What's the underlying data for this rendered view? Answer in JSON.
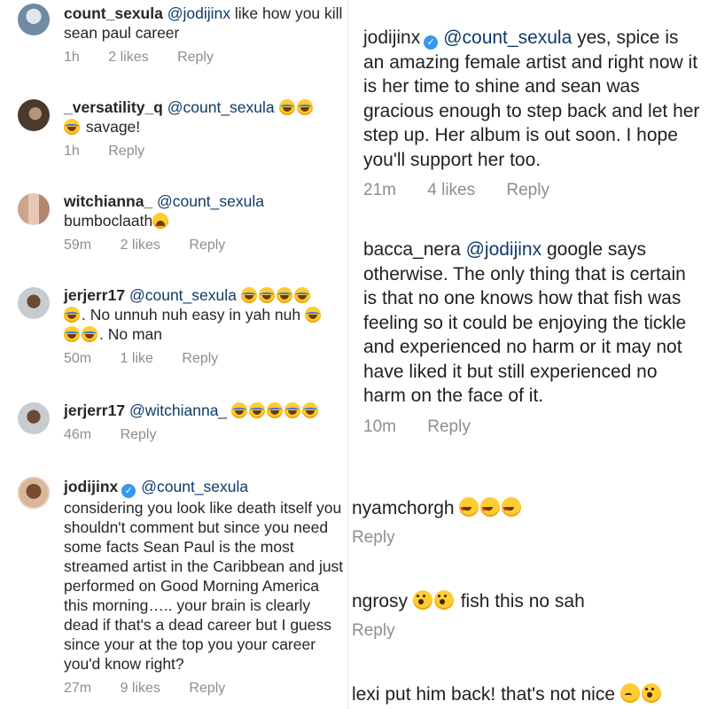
{
  "left_comments": [
    {
      "username": "count_sexula",
      "mention": "@jodijinx",
      "text": " like how you kill sean paul career",
      "time": "1h",
      "likes": "2 likes",
      "reply": "Reply"
    },
    {
      "username": "_versatility_q",
      "mention": "@count_sexula",
      "text": " savage!",
      "emoji_count": 3,
      "time": "1h",
      "reply": "Reply"
    },
    {
      "username": "witchianna_",
      "mention": "@count_sexula",
      "text": " bumboclaath",
      "time": "59m",
      "likes": "2 likes",
      "reply": "Reply"
    },
    {
      "username": "jerjerr17",
      "mention": "@count_sexula",
      "text_a": ". No unnuh nuh easy in yah nuh ",
      "text_b": ". No man",
      "time": "50m",
      "likes": "1 like",
      "reply": "Reply"
    },
    {
      "username": "jerjerr17",
      "mention": "@witchianna_",
      "time": "46m",
      "reply": "Reply"
    },
    {
      "username": "jodijinx",
      "mention": "@count_sexula",
      "text": "considering you look like death itself you shouldn't comment but since you need some facts Sean Paul is the most streamed artist in the Caribbean and just performed on Good Morning America this morning….. your brain is clearly dead if that's a dead career  but I guess since your at the top you your career you'd know right?",
      "time": "27m",
      "likes": "9 likes",
      "reply": "Reply"
    }
  ],
  "right_comments": [
    {
      "username": "jodijinx",
      "mention": "@count_sexula",
      "text": " yes, spice is an amazing female artist and right now it is her time to shine and sean was gracious enough to step back and let her step up. Her album is out soon. I hope you'll support her too.",
      "time": "21m",
      "likes": "4 likes",
      "reply": "Reply"
    },
    {
      "username": "bacca_nera",
      "mention": "@jodijinx",
      "text": " google says otherwise. The only thing that is certain is that no one knows how that fish was feeling so it could be enjoying the tickle and experienced no harm or it may not have liked it but still experienced no harm on the face of it.",
      "time": "10m",
      "reply": "Reply"
    },
    {
      "username": "nyamchorgh",
      "reply": "Reply"
    },
    {
      "username": "ngrosy",
      "text": " fish this no sah",
      "reply": "Reply"
    },
    {
      "username": "lexi",
      "text": " put him back! that's not nice "
    }
  ],
  "verified_mark": "✓",
  "colors": {
    "text": "#262626",
    "meta": "#8e8e8e",
    "mention": "#0f3b69",
    "verified": "#3897f0"
  }
}
